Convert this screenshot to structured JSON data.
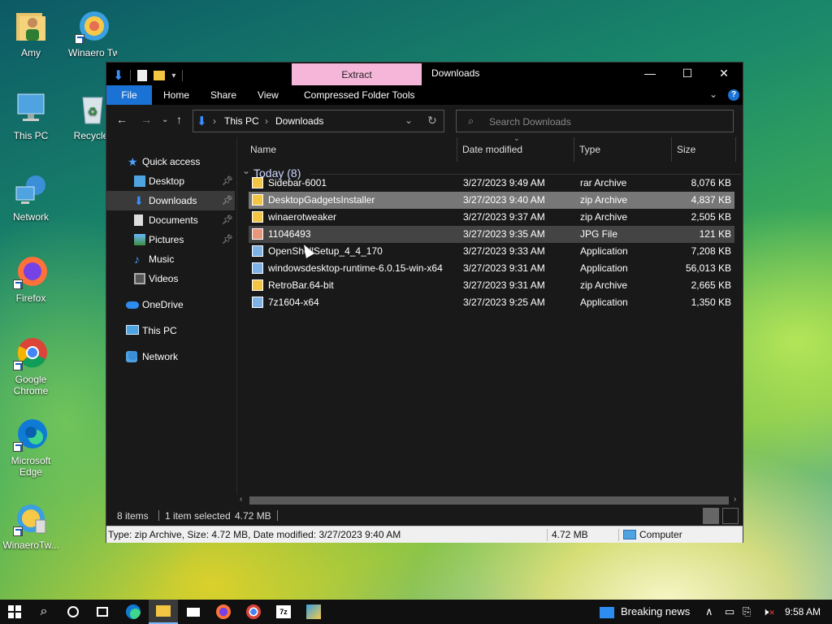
{
  "desktop": {
    "icons": [
      {
        "label": "Amy",
        "icon": "user-folder-icon"
      },
      {
        "label": "Winaero Tweak",
        "icon": "winaero-icon"
      },
      {
        "label": "This PC",
        "icon": "computer-icon"
      },
      {
        "label": "Recycle",
        "icon": "recycle-bin-icon"
      },
      {
        "label": "Network",
        "icon": "network-icon"
      },
      {
        "label": "Firefox",
        "icon": "firefox-icon"
      },
      {
        "label": "Google Chrome",
        "icon": "chrome-icon"
      },
      {
        "label": "Microsoft Edge",
        "icon": "edge-icon"
      },
      {
        "label": "WinaeroTw...",
        "icon": "winaero-icon"
      }
    ]
  },
  "explorer": {
    "title": "Downloads",
    "context_tab": "Extract",
    "ribbon_tabs": [
      "File",
      "Home",
      "Share",
      "View",
      "Compressed Folder Tools"
    ],
    "address": {
      "crumbs": [
        "This PC",
        "Downloads"
      ]
    },
    "search_placeholder": "Search Downloads",
    "nav": [
      {
        "label": "Quick access"
      },
      {
        "label": "Desktop"
      },
      {
        "label": "Downloads"
      },
      {
        "label": "Documents"
      },
      {
        "label": "Pictures"
      },
      {
        "label": "Music"
      },
      {
        "label": "Videos"
      },
      {
        "label": "OneDrive"
      },
      {
        "label": "This PC"
      },
      {
        "label": "Network"
      }
    ],
    "columns": [
      "Name",
      "Date modified",
      "Type",
      "Size"
    ],
    "group_label": "Today (8)",
    "files": [
      {
        "name": "Sidebar-6001",
        "date": "3/27/2023 9:49 AM",
        "type": "rar Archive",
        "size": "8,076 KB"
      },
      {
        "name": "DesktopGadgetsInstaller",
        "date": "3/27/2023 9:40 AM",
        "type": "zip Archive",
        "size": "4,837 KB"
      },
      {
        "name": "winaerotweaker",
        "date": "3/27/2023 9:37 AM",
        "type": "zip Archive",
        "size": "2,505 KB"
      },
      {
        "name": "11046493",
        "date": "3/27/2023 9:35 AM",
        "type": "JPG File",
        "size": "121 KB"
      },
      {
        "name": "OpenShellSetup_4_4_170",
        "date": "3/27/2023 9:33 AM",
        "type": "Application",
        "size": "7,208 KB"
      },
      {
        "name": "windowsdesktop-runtime-6.0.15-win-x64",
        "date": "3/27/2023 9:31 AM",
        "type": "Application",
        "size": "56,013 KB"
      },
      {
        "name": "RetroBar.64-bit",
        "date": "3/27/2023 9:31 AM",
        "type": "zip Archive",
        "size": "2,665 KB"
      },
      {
        "name": "7z1604-x64",
        "date": "3/27/2023 9:25 AM",
        "type": "Application",
        "size": "1,350 KB"
      }
    ],
    "status": {
      "items": "8 items",
      "selected": "1 item selected",
      "size": "4.72 MB"
    },
    "infobar": {
      "details": "Type: zip Archive, Size: 4.72 MB, Date modified: 3/27/2023 9:40 AM",
      "size": "4.72 MB",
      "location": "Computer"
    }
  },
  "taskbar": {
    "news": "Breaking news",
    "clock": "9:58 AM"
  }
}
